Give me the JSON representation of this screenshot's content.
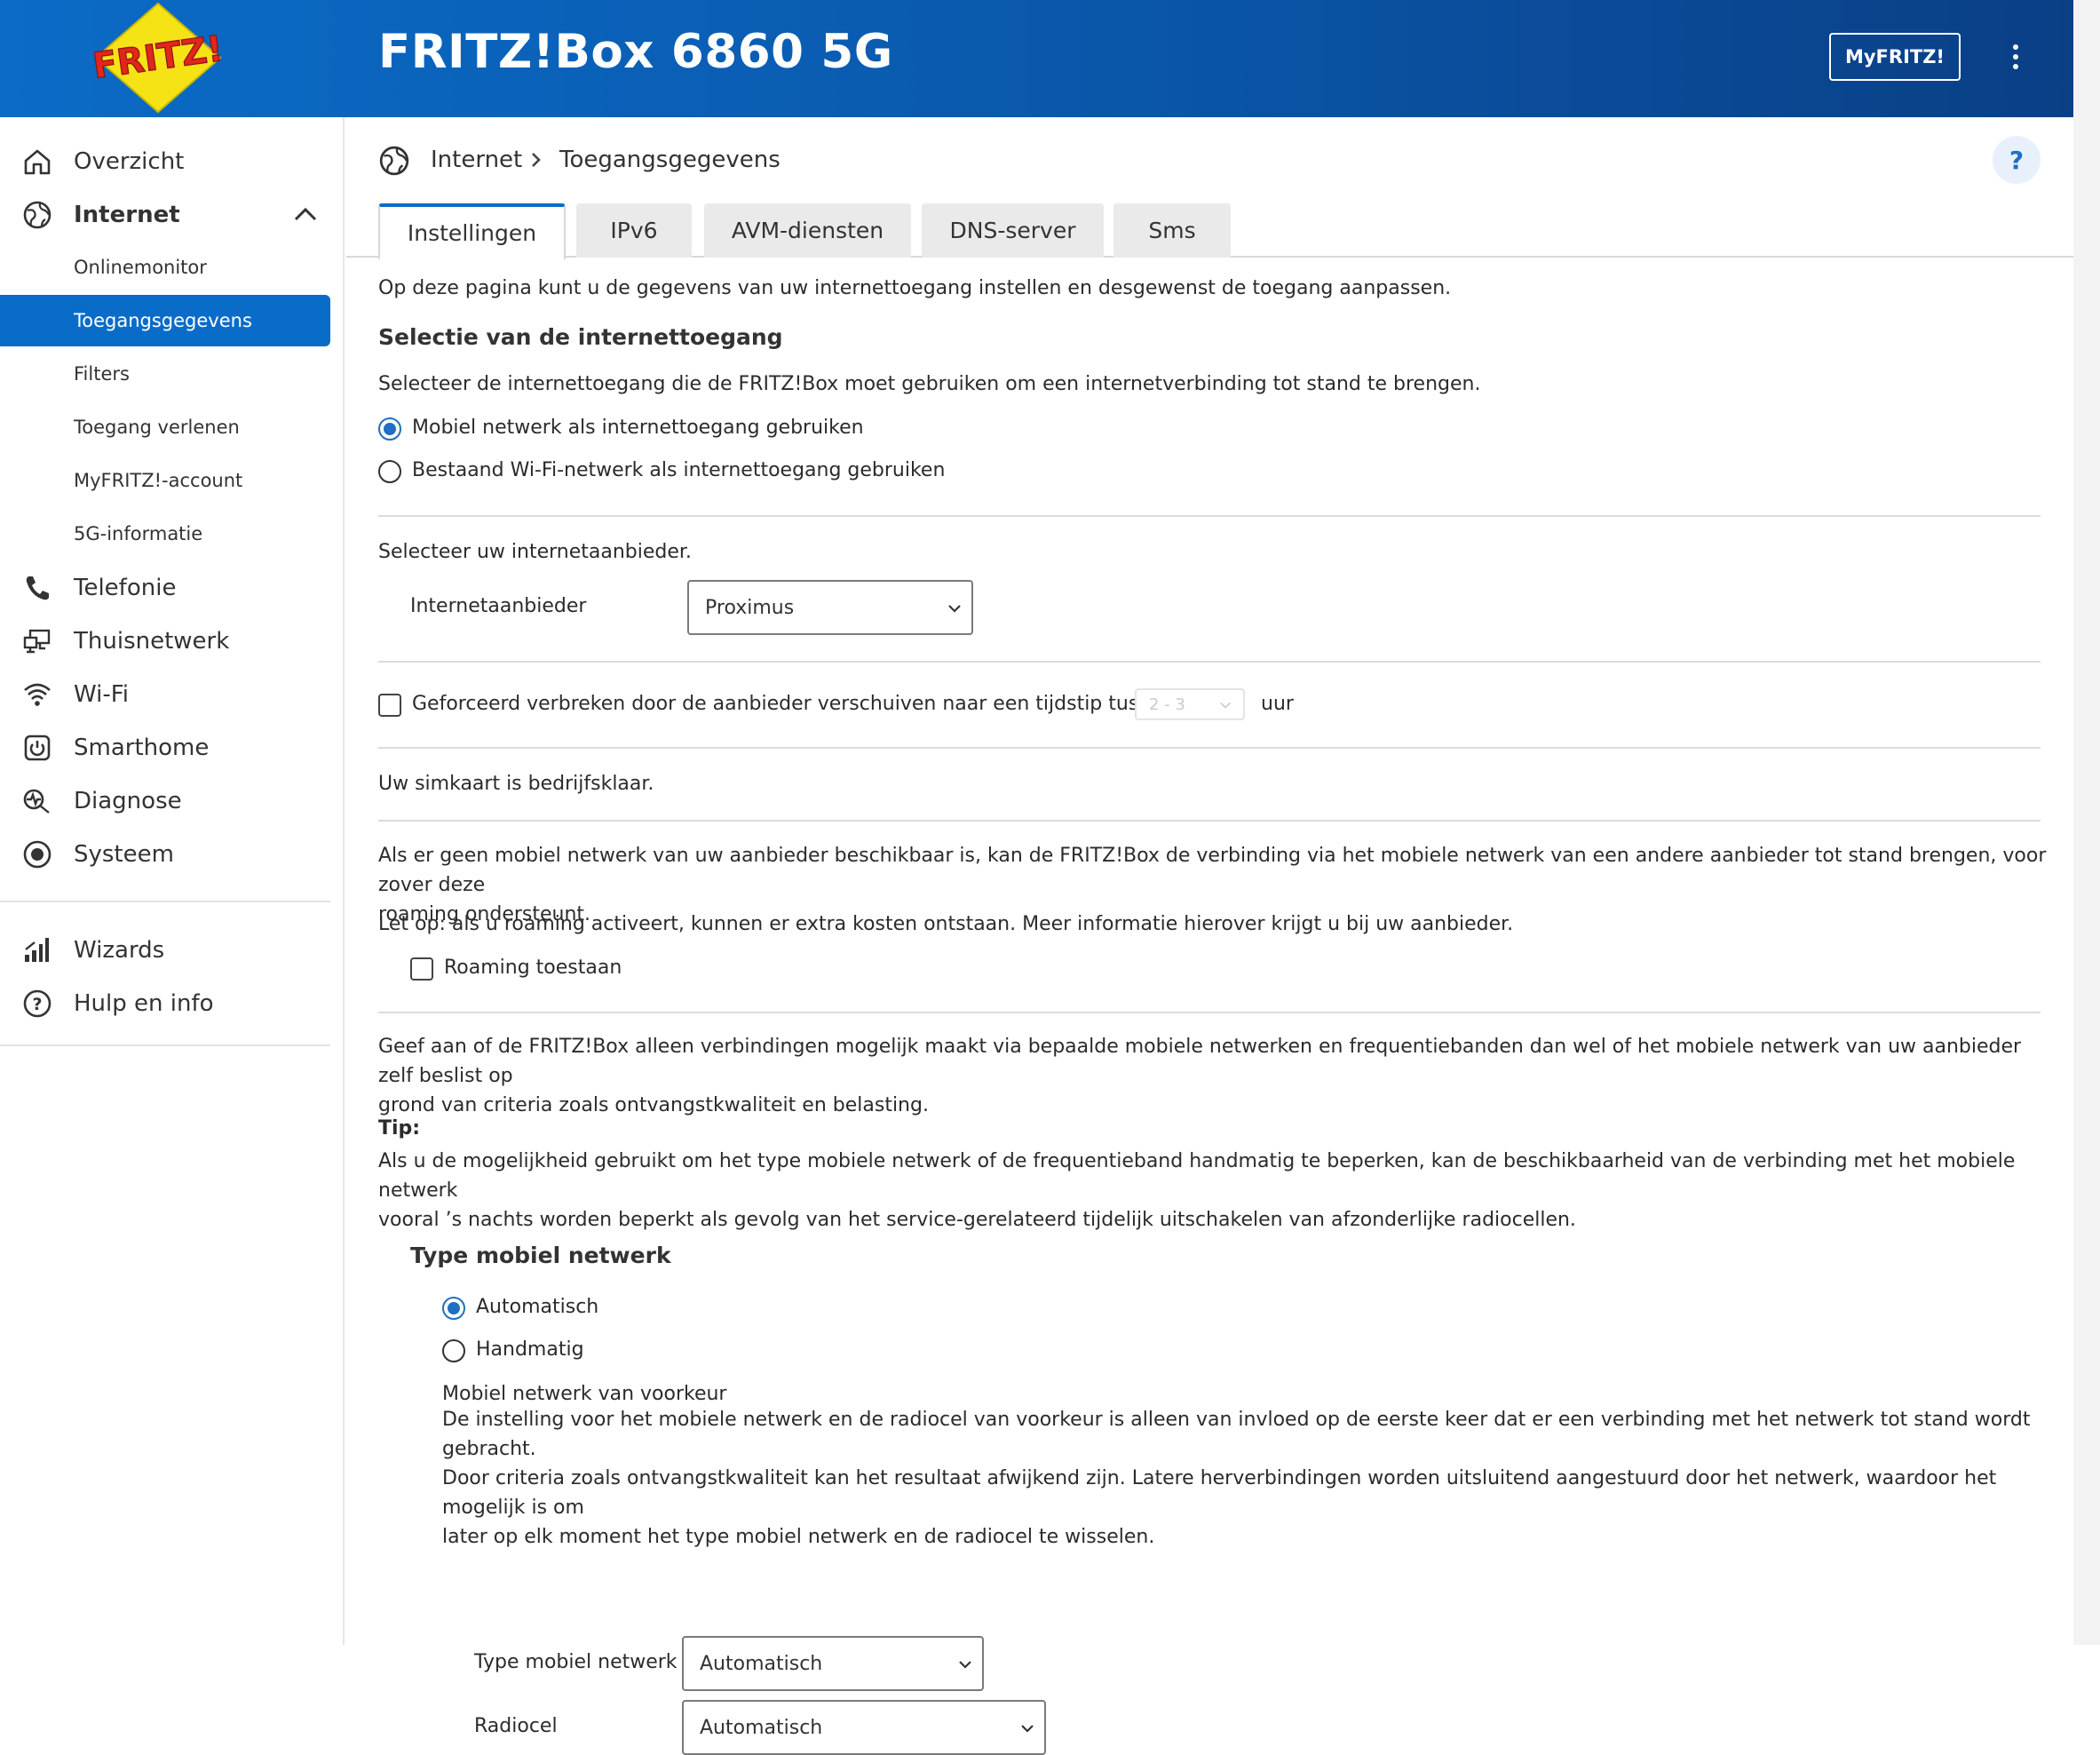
{
  "app": {
    "title": "FRITZ!Box 6860 5G",
    "myfritz_label": "MyFRITZ!",
    "logo_text": "FRITZ!"
  },
  "colors": {
    "header_blue": "#0a5bb0",
    "active_blue": "#0a6cc9",
    "radio_blue": "#1f6fc2"
  },
  "sidebar": {
    "items": [
      {
        "label": "Overzicht",
        "icon": "home-icon"
      },
      {
        "label": "Internet",
        "icon": "globe-icon",
        "expanded": true
      },
      {
        "label": "Telefonie",
        "icon": "phone-icon"
      },
      {
        "label": "Thuisnetwerk",
        "icon": "network-icon"
      },
      {
        "label": "Wi-Fi",
        "icon": "wifi-icon"
      },
      {
        "label": "Smarthome",
        "icon": "smarthome-icon"
      },
      {
        "label": "Diagnose",
        "icon": "diagnose-icon"
      },
      {
        "label": "Systeem",
        "icon": "system-icon"
      }
    ],
    "internet_subitems": [
      {
        "label": "Onlinemonitor"
      },
      {
        "label": "Toegangsgegevens",
        "active": true
      },
      {
        "label": "Filters"
      },
      {
        "label": "Toegang verlenen"
      },
      {
        "label": "MyFRITZ!-account"
      },
      {
        "label": "5G-informatie"
      }
    ],
    "bottom_items": [
      {
        "label": "Wizards",
        "icon": "wizard-icon"
      },
      {
        "label": "Hulp en info",
        "icon": "help-icon"
      }
    ]
  },
  "breadcrumb": {
    "section": "Internet",
    "page": "Toegangsgegevens",
    "help_label": "?"
  },
  "tabs": [
    {
      "label": "Instellingen",
      "active": true
    },
    {
      "label": "IPv6"
    },
    {
      "label": "AVM-diensten"
    },
    {
      "label": "DNS-server"
    },
    {
      "label": "Sms"
    }
  ],
  "content": {
    "intro": "Op deze pagina kunt u de gegevens van uw internettoegang instellen en desgewenst de toegang aanpassen.",
    "access_heading": "Selectie van de internettoegang",
    "access_desc": "Selecteer de internettoegang die de FRITZ!Box moet gebruiken om een internetverbinding tot stand te brengen.",
    "access_options": [
      {
        "label": "Mobiel netwerk als internettoegang gebruiken",
        "selected": true
      },
      {
        "label": "Bestaand Wi-Fi-netwerk als internettoegang gebruiken",
        "selected": false
      }
    ],
    "provider_prompt": "Selecteer uw internetaanbieder.",
    "provider_label": "Internetaanbieder",
    "provider_value": "Proximus",
    "forced_disconnect_label": "Geforceerd verbreken door de aanbieder verschuiven naar een tijdstip tussen",
    "forced_disconnect_value": "2 - 3",
    "forced_disconnect_unit": "uur",
    "forced_disconnect_checked": false,
    "sim_status": "Uw simkaart is bedrijfsklaar.",
    "roaming_line1": "Als er geen mobiel netwerk van uw aanbieder beschikbaar is, kan de FRITZ!Box de verbinding via het mobiele netwerk van een andere aanbieder tot stand brengen, voor zover deze",
    "roaming_line2": "roaming ondersteunt.",
    "roaming_note": "Let op: als u roaming activeert, kunnen er extra kosten ontstaan. Meer informatie hierover krijgt u bij uw aanbieder.",
    "roaming_label": "Roaming toestaan",
    "roaming_checked": false,
    "bands_line1": "Geef aan of de FRITZ!Box alleen verbindingen mogelijk maakt via bepaalde mobiele netwerken en frequentiebanden dan wel of het mobiele netwerk van uw aanbieder zelf beslist op",
    "bands_line2": "grond van criteria zoals ontvangstkwaliteit en belasting.",
    "tip_label": "Tip:",
    "tip_line1": "Als u de mogelijkheid gebruikt om het type mobiele netwerk of de frequentieband handmatig te beperken, kan de beschikbaarheid van de verbinding met het mobiele netwerk",
    "tip_line2": "vooral ’s nachts worden beperkt als gevolg van het service-gerelateerd tijdelijk uitschakelen van afzonderlijke radiocellen.",
    "network_type_heading": "Type mobiel netwerk",
    "network_type_options": [
      {
        "label": "Automatisch",
        "selected": true
      },
      {
        "label": "Handmatig",
        "selected": false
      }
    ],
    "preferred_heading": "Mobiel netwerk van voorkeur",
    "preferred_line1": "De instelling voor het mobiele netwerk en de radiocel van voorkeur is alleen van invloed op de eerste keer dat er een verbinding met het netwerk tot stand wordt gebracht.",
    "preferred_line2": "Door criteria zoals ontvangstkwaliteit kan het resultaat afwijkend zijn. Latere herverbindingen worden uitsluitend aangestuurd door het netwerk, waardoor het mogelijk is om",
    "preferred_line3": "later op elk moment het type mobiel netwerk en de radiocel te wisselen.",
    "type_label": "Type mobiel netwerk",
    "type_value": "Automatisch",
    "cell_label": "Radiocel",
    "cell_value": "Automatisch"
  }
}
